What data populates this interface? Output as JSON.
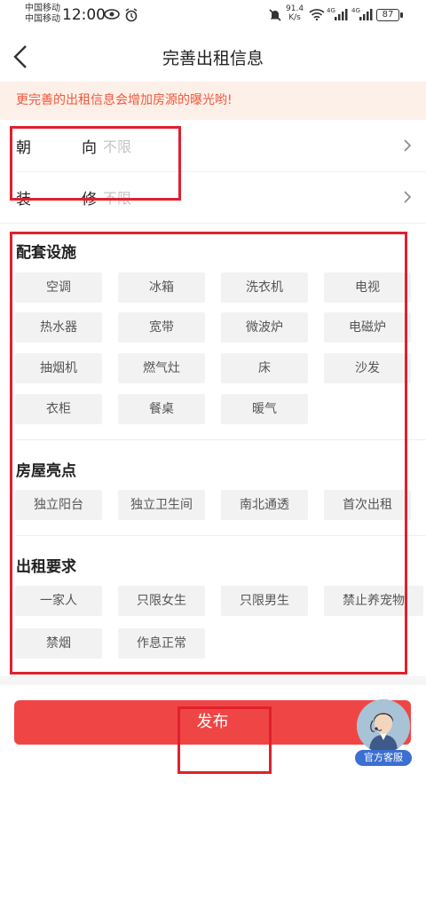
{
  "status_bar": {
    "carrier_1": "中国移动",
    "carrier_2": "中国移动",
    "time": "12:00",
    "net_speed_value": "91.4",
    "net_speed_unit": "K/s",
    "signal_label_1": "4G",
    "signal_label_2": "4G",
    "battery": "87",
    "icons": [
      "eye-icon",
      "alarm-icon",
      "mute-icon",
      "wifi-icon",
      "signal-icon",
      "battery-icon"
    ]
  },
  "nav": {
    "title": "完善出租信息"
  },
  "notice": "更完善的出租信息会增加房源的曝光哟!",
  "rows": [
    {
      "label_1": "朝",
      "label_2": "向",
      "value": "不限"
    },
    {
      "label_1": "装",
      "label_2": "修",
      "value": "不限"
    }
  ],
  "facilities": {
    "title": "配套设施",
    "tags": [
      "空调",
      "冰箱",
      "洗衣机",
      "电视",
      "热水器",
      "宽带",
      "微波炉",
      "电磁炉",
      "抽烟机",
      "燃气灶",
      "床",
      "沙发",
      "衣柜",
      "餐桌",
      "暖气"
    ]
  },
  "highlights": {
    "title": "房屋亮点",
    "tags": [
      "独立阳台",
      "独立卫生间",
      "南北通透",
      "首次出租"
    ]
  },
  "requirements": {
    "title": "出租要求",
    "tags": [
      "一家人",
      "只限女生",
      "只限男生",
      "禁止养宠物",
      "禁烟",
      "作息正常"
    ]
  },
  "publish_label": "发布",
  "service_label": "官方客服",
  "colors": {
    "accent": "#f04545",
    "notice_text": "#f0583c",
    "notice_bg": "#fdf0e8",
    "annotation": "#e0202e",
    "service_badge": "#3b6fd1"
  }
}
